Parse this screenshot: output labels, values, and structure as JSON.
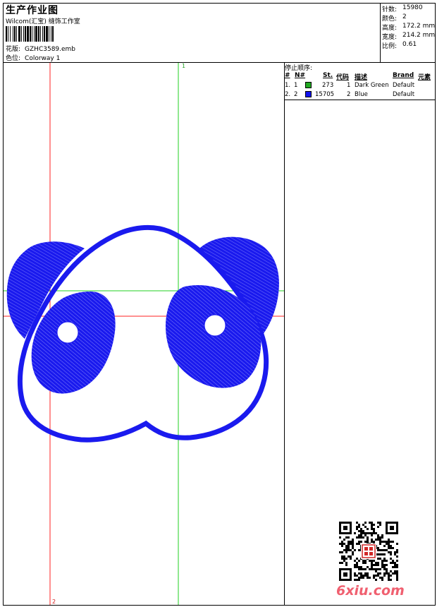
{
  "header": {
    "title": "生产作业图",
    "company": "Wilcom(汇宝) 缝饰工作室",
    "design_label": "花版:",
    "design_value": "GZHC3589.emb",
    "colorway_label": "色位:",
    "colorway_value": "Colorway 1"
  },
  "stats": [
    {
      "label": "针数:",
      "value": "15980"
    },
    {
      "label": "颜色:",
      "value": "2"
    },
    {
      "label": "高度:",
      "value": "172.2 mm"
    },
    {
      "label": "宽度:",
      "value": "214.2 mm"
    },
    {
      "label": "比例:",
      "value": "0.61"
    }
  ],
  "guides": {
    "green_label": "1",
    "red_label": "2"
  },
  "sequence": {
    "title": "停止顺序:",
    "columns": [
      "#",
      "N#",
      "St.",
      "代码",
      "描述",
      "Brand",
      "元素"
    ],
    "rows": [
      {
        "num": "1.",
        "n": "1",
        "color": "#22aa22",
        "stitches": "273",
        "code": "1",
        "desc": "Dark Green",
        "brand": "Default"
      },
      {
        "num": "2.",
        "n": "2",
        "color": "#1111ee",
        "stitches": "15705",
        "code": "2",
        "desc": "Blue",
        "brand": "Default"
      }
    ]
  },
  "thread_color": "#1a1aee",
  "watermark": "6xiu.com"
}
